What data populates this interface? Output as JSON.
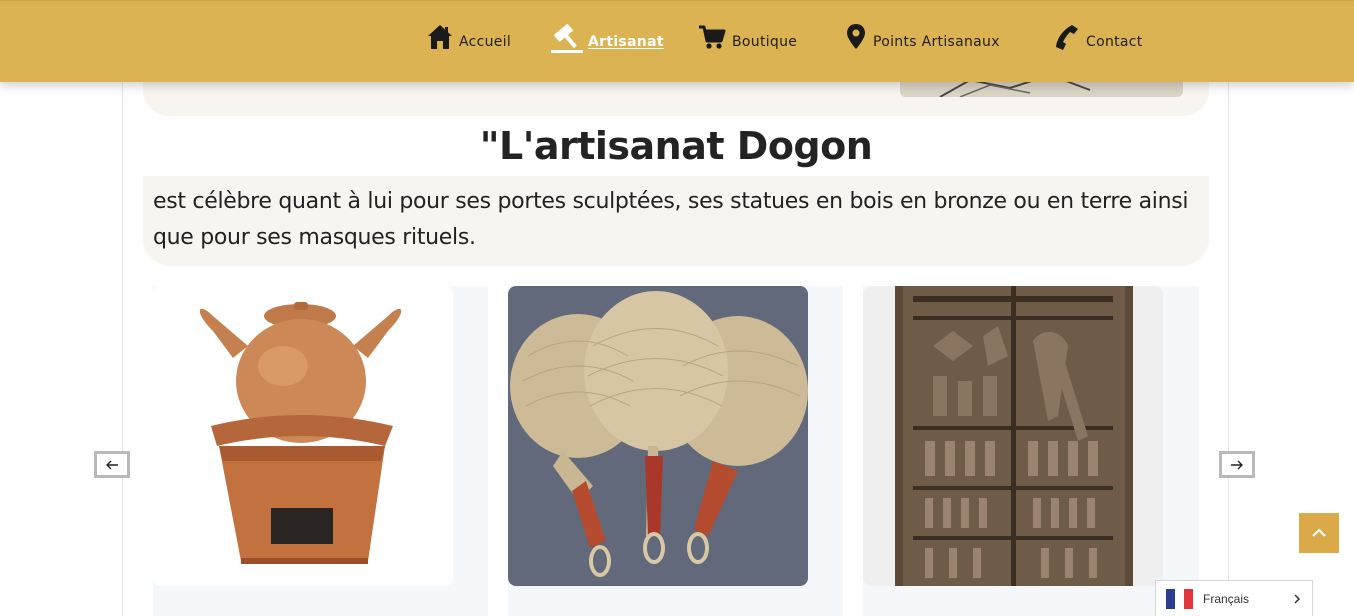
{
  "nav": {
    "items": [
      {
        "label": "Accueil",
        "icon": "home-icon",
        "active": false
      },
      {
        "label": "Artisanat",
        "icon": "hammer-icon",
        "active": true
      },
      {
        "label": "Boutique",
        "icon": "cart-icon",
        "active": false
      },
      {
        "label": "Points Artisanaux",
        "icon": "map-pin-icon",
        "active": false
      },
      {
        "label": "Contact",
        "icon": "phone-icon",
        "active": false
      }
    ]
  },
  "section": {
    "title": "\"L'artisanat Dogon",
    "description": "est célèbre quant à lui pour ses portes sculptées, ses statues en bois en bronze ou en terre ainsi que pour ses masques rituels."
  },
  "carousel": {
    "slides": [
      {
        "image": "terracotta-pot-on-stove"
      },
      {
        "image": "woven-straw-fans"
      },
      {
        "image": "carved-dogon-door"
      }
    ],
    "prev_icon": "arrow-left-icon",
    "next_icon": "arrow-right-icon"
  },
  "widgets": {
    "back_to_top_icon": "chevron-up-icon",
    "language": {
      "label": "Français",
      "flag": "france-flag-icon",
      "chevron": "chevron-right-icon"
    }
  },
  "colors": {
    "header_bg": "#dbb352",
    "card_bg": "#f8f5f0",
    "accent": "#dba948",
    "nav_text": "#1f1f1f",
    "nav_active_text": "#ffffff"
  }
}
